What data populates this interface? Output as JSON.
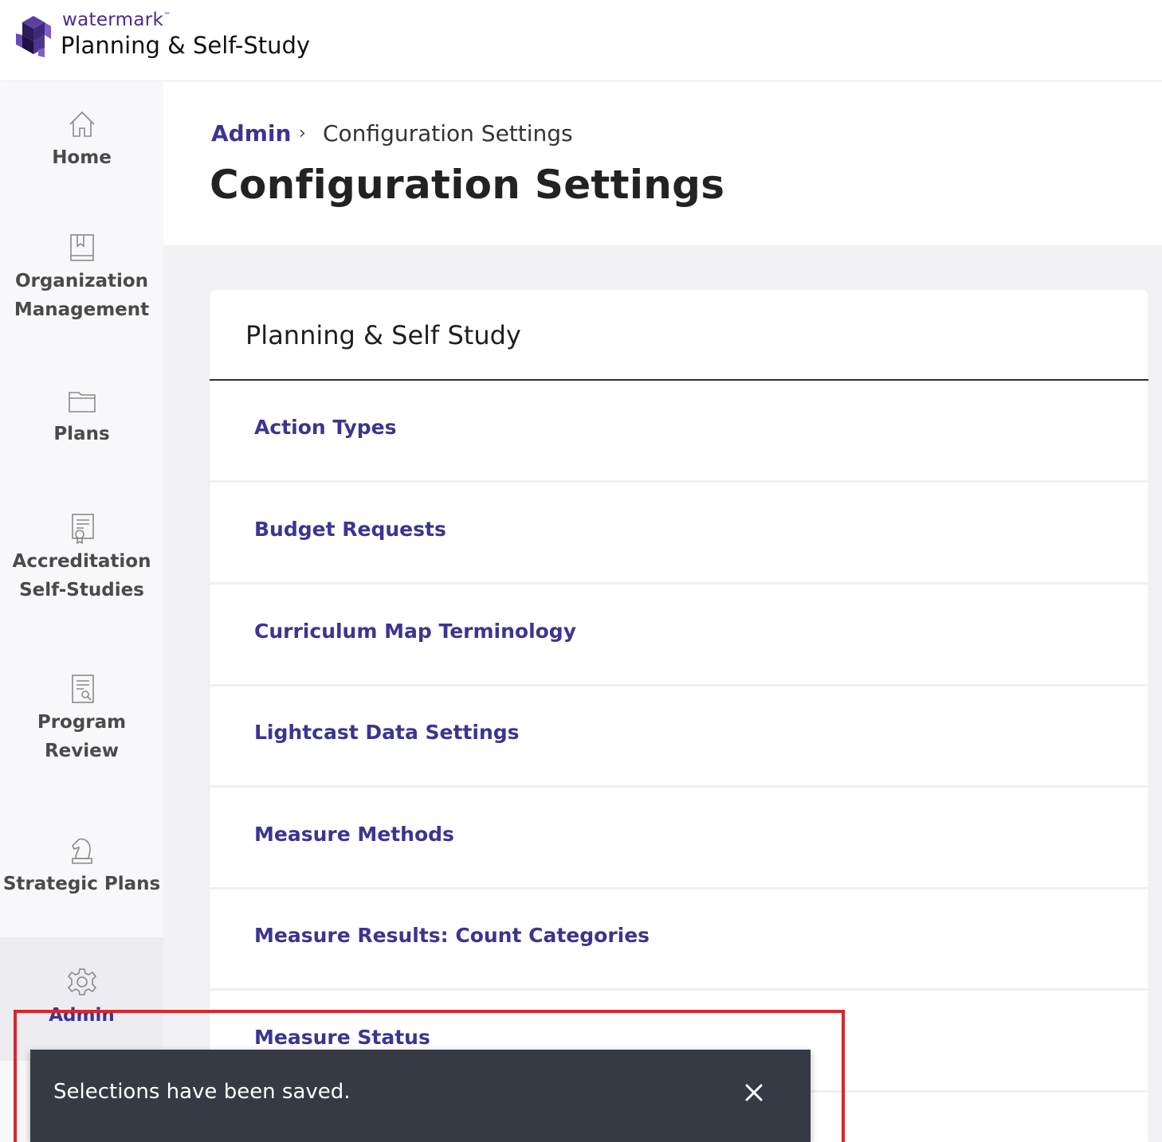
{
  "header": {
    "brand_small": "watermark",
    "brand_tm": "™",
    "product": "Planning & Self-Study"
  },
  "sidebar": {
    "items": [
      {
        "label": "Home",
        "icon": "home-icon"
      },
      {
        "label": "Organization Management",
        "icon": "book-icon"
      },
      {
        "label": "Plans",
        "icon": "folder-icon"
      },
      {
        "label": "Accreditation Self-Studies",
        "icon": "certificate-icon"
      },
      {
        "label": "Program Review",
        "icon": "document-search-icon"
      },
      {
        "label": "Strategic Plans",
        "icon": "chess-knight-icon"
      },
      {
        "label": "Admin",
        "icon": "gear-icon",
        "active": true
      }
    ]
  },
  "breadcrumb": {
    "parent": "Admin",
    "separator": "›",
    "current": "Configuration Settings"
  },
  "page_title": "Configuration Settings",
  "card": {
    "title": "Planning & Self Study",
    "links": [
      "Action Types",
      "Budget Requests",
      "Curriculum Map Terminology",
      "Lightcast Data Settings",
      "Measure Methods",
      "Measure Results: Count Categories",
      "Measure Status"
    ]
  },
  "toast": {
    "message": "Selections have been saved.",
    "close_icon": "close-icon"
  },
  "colors": {
    "accent": "#3b3591",
    "brand": "#4b2a8a",
    "toast_bg": "#363a45",
    "highlight": "#d9262c"
  }
}
